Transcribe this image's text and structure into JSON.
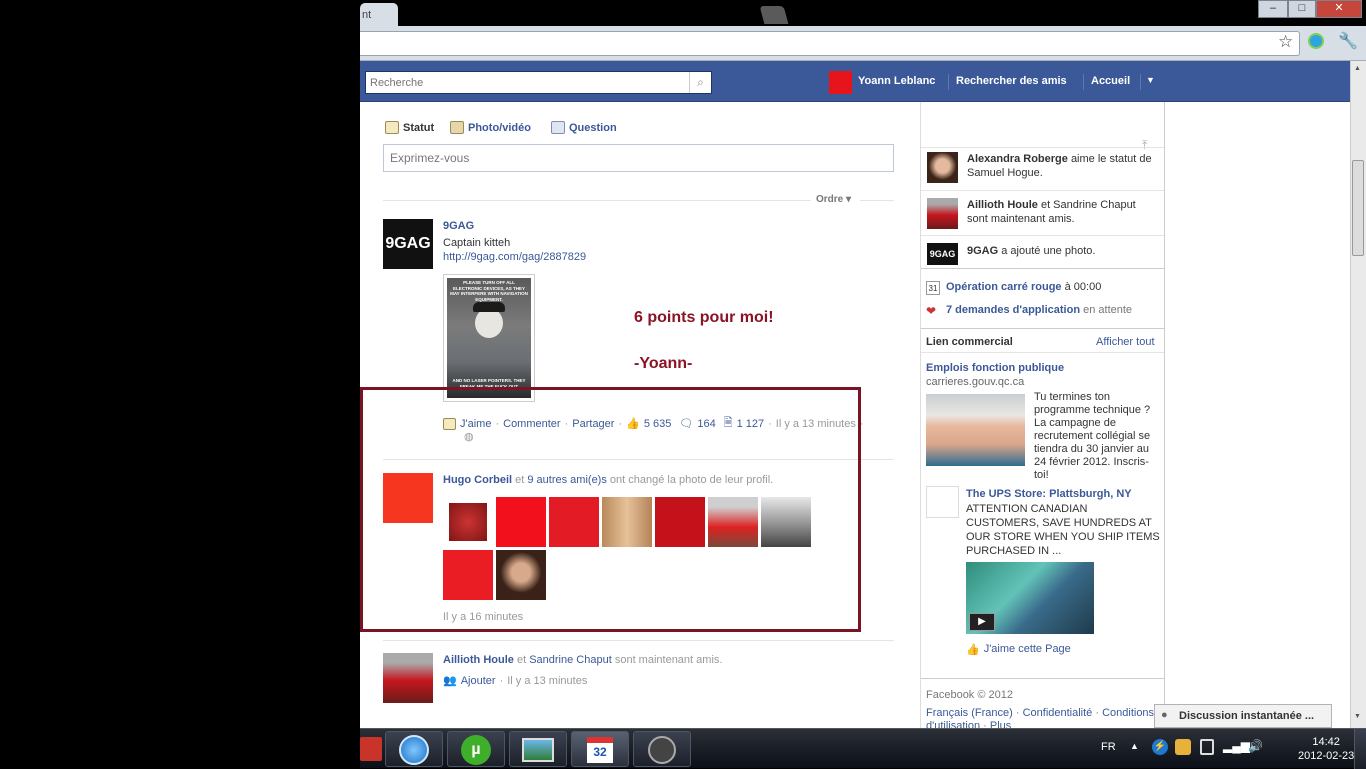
{
  "browser": {
    "tab_title": "nt",
    "window_buttons": [
      "–",
      "□",
      "✕"
    ]
  },
  "fb_header": {
    "search_placeholder": "Recherche",
    "user_name": "Yoann Leblanc",
    "find_friends": "Rechercher des amis",
    "home": "Accueil"
  },
  "composer": {
    "tabs": [
      "Statut",
      "Photo/vidéo",
      "Question"
    ],
    "placeholder": "Exprimez-vous",
    "order_label": "Ordre"
  },
  "post_9gag": {
    "author": "9GAG",
    "text": "Captain kitteh",
    "link": "http://9gag.com/gag/2887829",
    "image_caption_top": "PLEASE TURN OFF ALL ELECTRONIC DEVICES, AS THEY MAY INTERFERE WITH NAVIGATION EQUIPMENT.",
    "image_caption_bottom": "AND NO LASER POINTERS. THEY FREAK ME THE FUCK OUT",
    "like": "J'aime",
    "comment": "Commenter",
    "share": "Partager",
    "likes_count": "5 635",
    "comments_count": "164",
    "shares_count": "1 127",
    "time": "Il y a 13 minutes"
  },
  "annotation": {
    "line1": "6 points pour moi!",
    "line2": "-Yoann-"
  },
  "post_profile": {
    "author": "Hugo Corbeil",
    "connector": "et",
    "others": "9 autres ami(e)s",
    "action": "ont changé la photo de leur profil.",
    "time": "Il y a 16 minutes"
  },
  "post_friends": {
    "author": "Aillioth Houle",
    "connector": "et",
    "friend": "Sandrine Chaput",
    "action": "sont maintenant amis.",
    "add": "Ajouter",
    "time": "Il y a 13 minutes"
  },
  "ticker": [
    {
      "name": "Alexandra Roberge",
      "text": "aime le statut de Samuel Hogue."
    },
    {
      "name": "Aillioth Houle",
      "text": "et Sandrine Chaput sont maintenant amis."
    },
    {
      "name": "9GAG",
      "text": "a ajouté une photo."
    }
  ],
  "events": {
    "event_name": "Opération carré rouge",
    "event_time": "à 00:00",
    "requests": "7 demandes d'application",
    "requests_suffix": "en attente",
    "calendar_day": "31"
  },
  "ads": {
    "title": "Lien commercial",
    "show_all": "Afficher tout",
    "ad1_title": "Emplois fonction publique",
    "ad1_domain": "carrieres.gouv.qc.ca",
    "ad1_body": "Tu termines ton programme technique ? La campagne de recrutement collégial se tiendra du 30 janvier au 24 février 2012. Inscris-toi!",
    "ad2_title": "The UPS Store: Plattsburgh, NY",
    "ad2_body": "ATTENTION CANADIAN CUSTOMERS, SAVE HUNDREDS AT OUR STORE WHEN YOU SHIP ITEMS PURCHASED IN ...",
    "ad2_like": "J'aime cette Page"
  },
  "footer": {
    "copyright": "Facebook © 2012",
    "lang": "Français (France)",
    "privacy": "Confidentialité",
    "terms": "Conditions d'utilisation",
    "more": "Plus"
  },
  "chat": {
    "label": "Discussion instantanée ..."
  },
  "taskbar": {
    "lang": "FR",
    "time": "14:42",
    "date": "2012-02-23",
    "cal_badge": "32"
  },
  "colors": {
    "fb_blue": "#3b5998",
    "annotation": "#8b1424",
    "highlight": "#7a1425"
  }
}
